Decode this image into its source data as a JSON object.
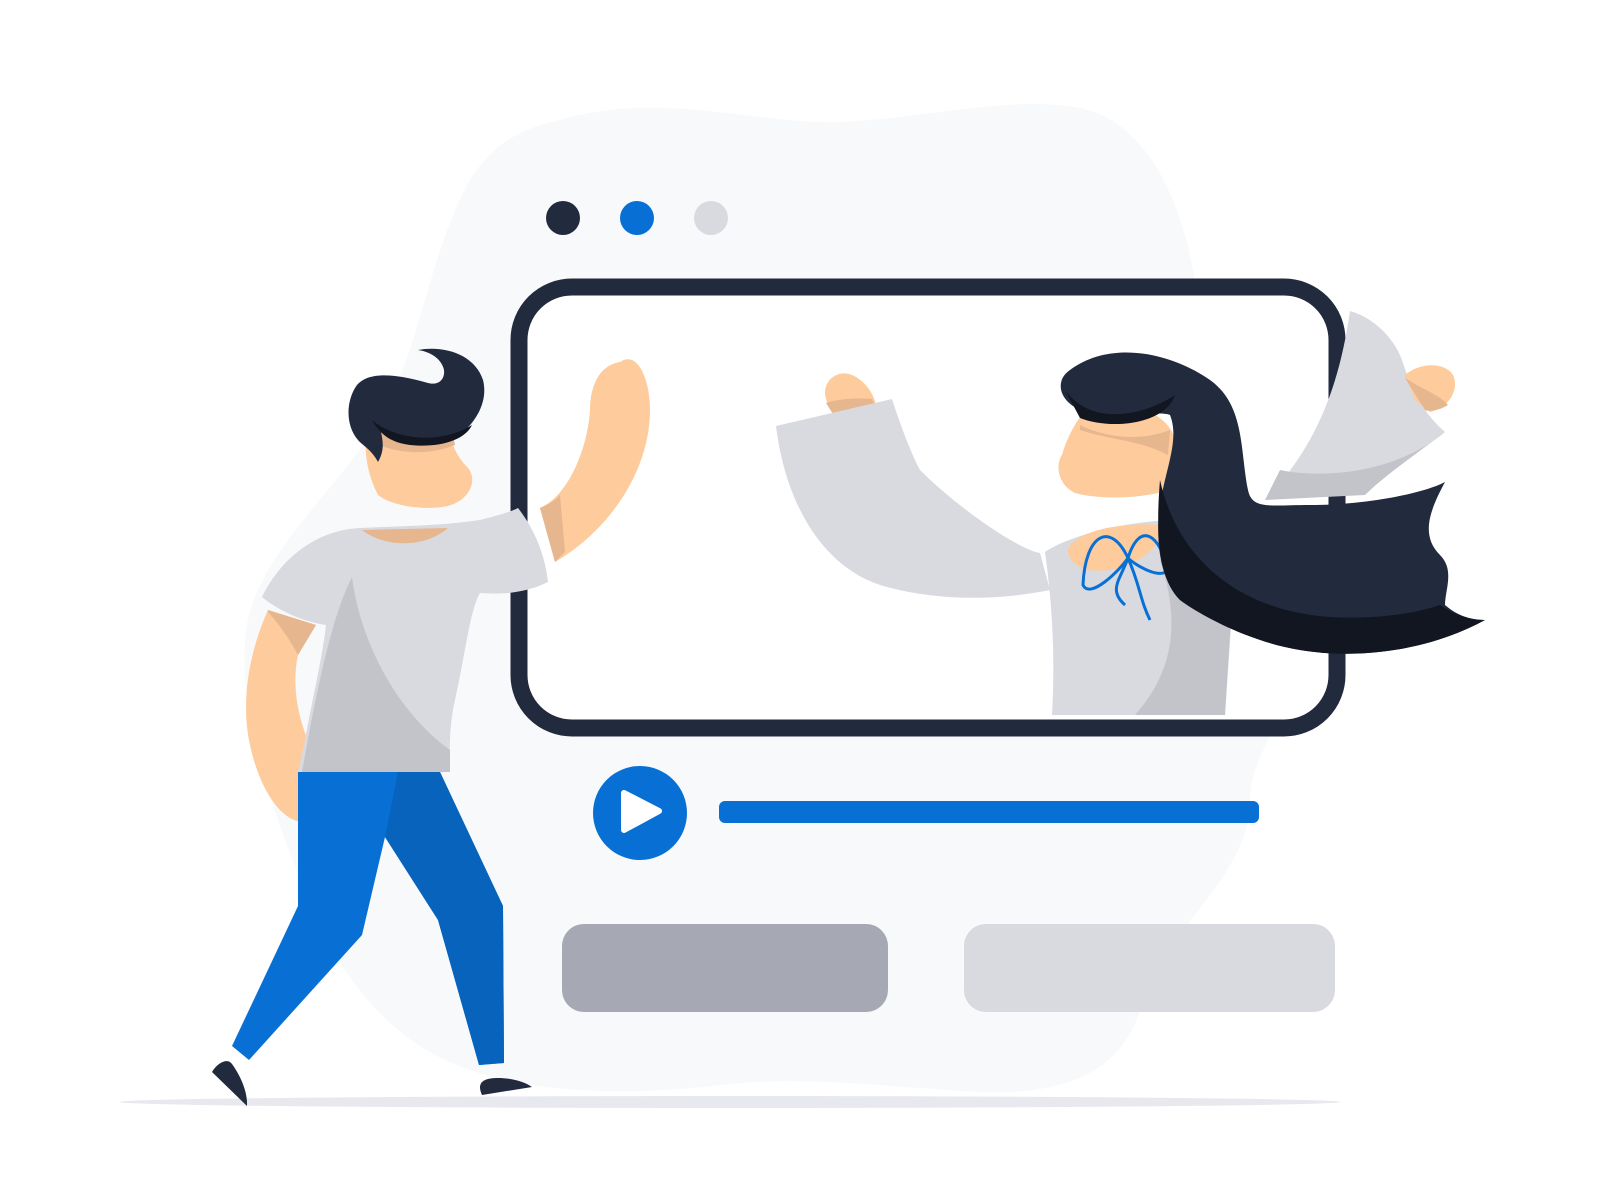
{
  "window": {
    "traffic_lights": [
      {
        "name": "dark-dot",
        "color": "#222A3E"
      },
      {
        "name": "blue-dot",
        "color": "#0870D4"
      },
      {
        "name": "gray-dot",
        "color": "#D9DAE0"
      }
    ]
  },
  "colors": {
    "blob_background": "#F8F9FB",
    "frame_stroke": "#222A3E",
    "accent_blue": "#0870D4",
    "dark_blue": "#0763BC",
    "button_dark_gray": "#A6A8B3",
    "button_light_gray": "#D9DAE0",
    "skin": "#FDCB9C",
    "skin_shadow": "#E6B68E",
    "shirt": "#D9DAE0",
    "shirt_shadow": "#C3C4C9",
    "hair": "#222A3E",
    "hair_shadow": "#121620",
    "ground_shadow": "#E8E9EE"
  },
  "player": {
    "play_icon": "play-icon",
    "progress": 1.0
  },
  "buttons": [
    {
      "name": "primary-button",
      "style": "dark-gray"
    },
    {
      "name": "secondary-button",
      "style": "light-gray"
    }
  ]
}
